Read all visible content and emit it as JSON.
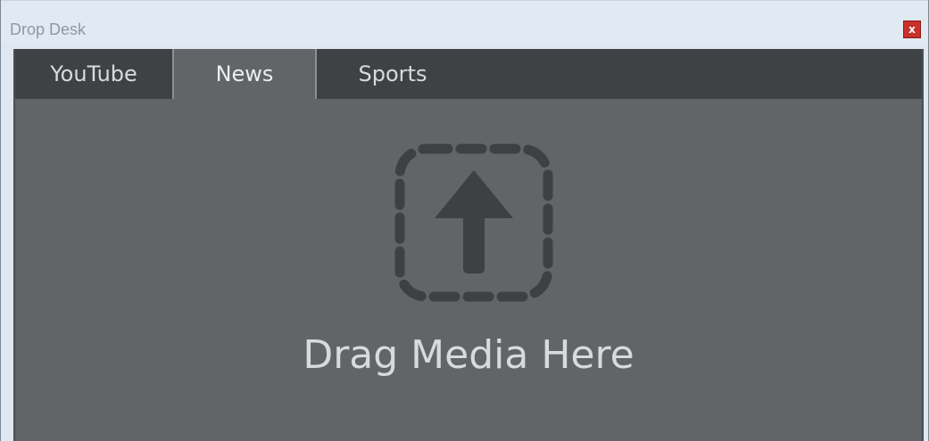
{
  "window": {
    "title": "Drop Desk",
    "close_glyph": "x",
    "close_icon": "close-icon"
  },
  "tabs": [
    {
      "label": "YouTube",
      "active": false
    },
    {
      "label": "News",
      "active": true
    },
    {
      "label": "Sports",
      "active": false
    }
  ],
  "dropzone": {
    "icon": "upload-arrow-icon",
    "label": "Drag Media Here"
  },
  "colors": {
    "titlebar": "#e1e9f3",
    "tabstrip": "#3f4245",
    "panel": "#626567",
    "icon": "#3e4143",
    "label": "#d8dadc",
    "close": "#c9302c"
  }
}
